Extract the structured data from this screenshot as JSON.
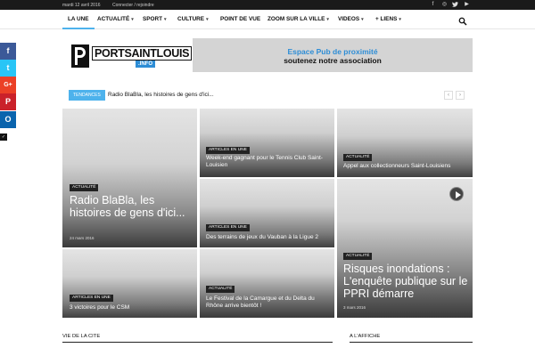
{
  "topbar": {
    "date": "mardi 12 avril 2016",
    "login": "Connecter / rejoindre",
    "social_icons": [
      "facebook-icon",
      "instagram-icon",
      "twitter-icon",
      "youtube-icon"
    ]
  },
  "nav": {
    "items": [
      {
        "label": "LA UNE",
        "active": true,
        "dropdown": false
      },
      {
        "label": "ACTUALITÉ",
        "dropdown": true
      },
      {
        "label": "SPORT",
        "dropdown": true
      },
      {
        "label": "CULTURE",
        "dropdown": true
      },
      {
        "label": "POINT DE VUE",
        "dropdown": false
      },
      {
        "label": "ZOOM SUR LA VILLE",
        "dropdown": true
      },
      {
        "label": "VIDEOS",
        "dropdown": true
      },
      {
        "label": "+ LIENS",
        "dropdown": true
      }
    ],
    "chevron": "▾"
  },
  "logo": {
    "main": "PORTSAINTLOUIS",
    "sub": ".INFO"
  },
  "ad": {
    "line1": "Espace Pub de proximité",
    "line2": "soutenez notre association"
  },
  "trending": {
    "badge": "TENDANCES",
    "text": "Radio BlaBla, les histoires de gens d'ici...",
    "prev": "‹",
    "next": "›"
  },
  "share": {
    "facebook": "f",
    "twitter": "t",
    "google": "G+",
    "pinterest": "P",
    "outlook": "O",
    "small": "✓"
  },
  "tiles": [
    {
      "tag": "ACTUALITÉ",
      "title": "Radio BlaBla, les histoires de gens d'ici...",
      "date": "24 mars 2016"
    },
    {
      "tag": "ARTICLES EN UNE",
      "title": "Week-end gagnant pour le Tennis Club Saint-Louisien"
    },
    {
      "tag": "ACTUALITÉ",
      "title": "Appel aux collectionneurs Saint-Louisiens"
    },
    {
      "tag": "ARTICLES EN UNE",
      "title": "Des terrains de jeux du Vauban à la Ligue 2"
    },
    {
      "tag": "ACTUALITÉ",
      "title": "Risques inondations : L'enquête publique sur le PPRI démarre",
      "date": "3 mars 2016"
    },
    {
      "tag": "ARTICLES EN UNE",
      "title": "3 victoires pour le CSM"
    },
    {
      "tag": "ACTUALITÉ",
      "title": "Le Festival de la Camargue et du Delta du Rhône arrive bientôt !"
    }
  ],
  "sections": {
    "left": "VIE DE LA CITE",
    "right": "A L'AFFICHE"
  },
  "colors": {
    "accent": "#4db2ec",
    "dark": "#111111",
    "brand_blue": "#2d8dd6"
  }
}
